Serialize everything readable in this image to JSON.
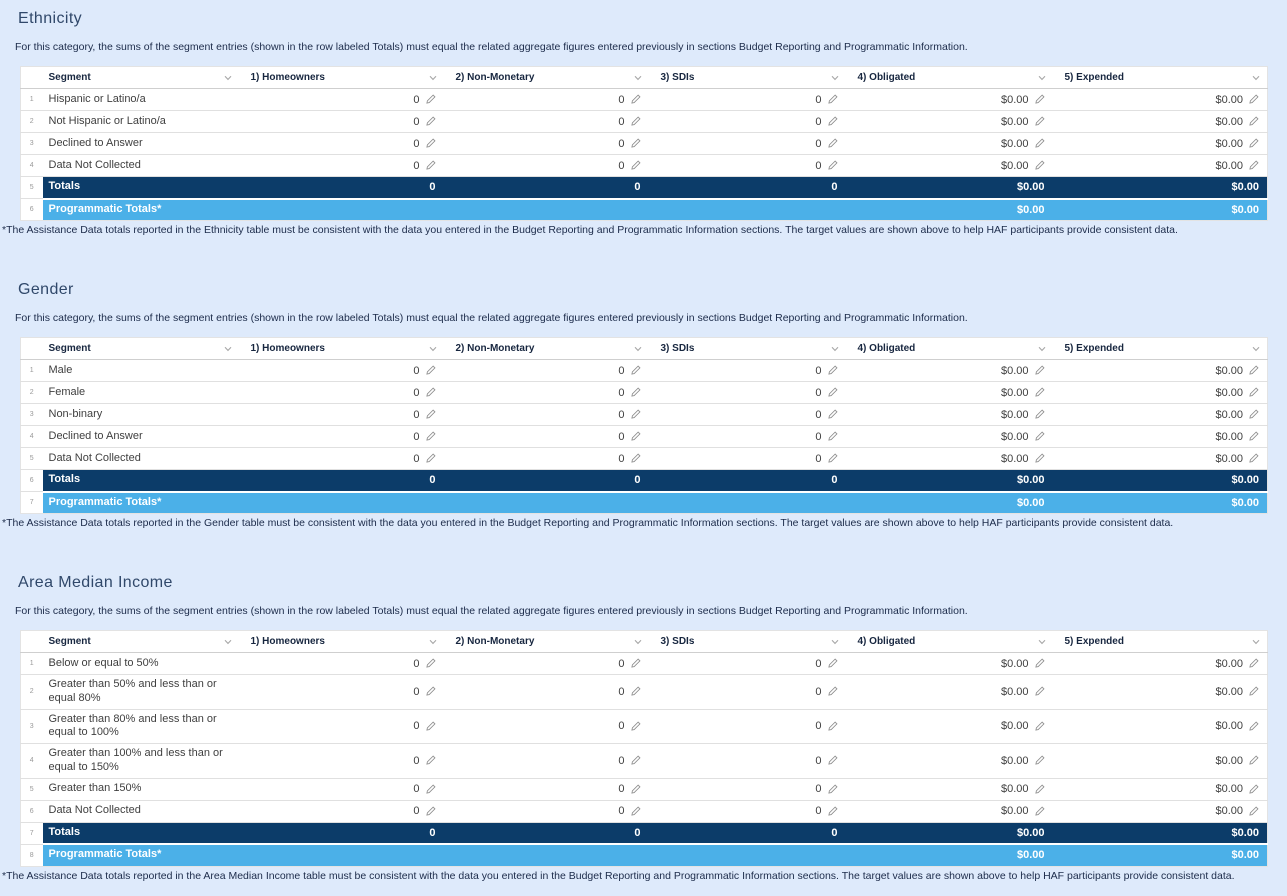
{
  "colors": {
    "page-bg": "#deeafb",
    "navy": "#0c3c69",
    "light-blue": "#4bb0e8",
    "heading": "#30486a"
  },
  "columns": [
    {
      "key": "segment",
      "label": "Segment"
    },
    {
      "key": "homeowners",
      "label": "1) Homeowners"
    },
    {
      "key": "nonmonetary",
      "label": "2) Non-Monetary"
    },
    {
      "key": "sdis",
      "label": "3) SDIs"
    },
    {
      "key": "obligated",
      "label": "4) Obligated"
    },
    {
      "key": "expended",
      "label": "5) Expended"
    }
  ],
  "sections": [
    {
      "id": "ethnicity",
      "title": "Ethnicity",
      "description": "For this category, the sums of the segment entries (shown in the row labeled Totals) must equal the related aggregate figures entered previously in sections Budget Reporting and Programmatic Information.",
      "rows": [
        {
          "index": "1",
          "segment": "Hispanic or Latino/a",
          "values": [
            "0",
            "0",
            "0",
            "$0.00",
            "$0.00"
          ]
        },
        {
          "index": "2",
          "segment": "Not Hispanic or Latino/a",
          "values": [
            "0",
            "0",
            "0",
            "$0.00",
            "$0.00"
          ]
        },
        {
          "index": "3",
          "segment": "Declined to Answer",
          "values": [
            "0",
            "0",
            "0",
            "$0.00",
            "$0.00"
          ]
        },
        {
          "index": "4",
          "segment": "Data Not Collected",
          "values": [
            "0",
            "0",
            "0",
            "$0.00",
            "$0.00"
          ]
        }
      ],
      "totals_row": {
        "index": "5",
        "segment": "Totals",
        "values": [
          "0",
          "0",
          "0",
          "$0.00",
          "$0.00"
        ]
      },
      "programmatic_row": {
        "index": "6",
        "segment": "Programmatic Totals*",
        "values": [
          "",
          "",
          "",
          "$0.00",
          "$0.00"
        ]
      },
      "footnote": "*The Assistance Data totals reported in the Ethnicity table must be consistent with the data you entered in the Budget Reporting and Programmatic Information sections. The target values are shown above to help HAF participants provide consistent data."
    },
    {
      "id": "gender",
      "title": "Gender",
      "description": "For this category, the sums of the segment entries (shown in the row labeled Totals) must equal the related aggregate figures entered previously in sections Budget Reporting and Programmatic Information.",
      "rows": [
        {
          "index": "1",
          "segment": "Male",
          "values": [
            "0",
            "0",
            "0",
            "$0.00",
            "$0.00"
          ]
        },
        {
          "index": "2",
          "segment": "Female",
          "values": [
            "0",
            "0",
            "0",
            "$0.00",
            "$0.00"
          ]
        },
        {
          "index": "3",
          "segment": "Non-binary",
          "values": [
            "0",
            "0",
            "0",
            "$0.00",
            "$0.00"
          ]
        },
        {
          "index": "4",
          "segment": "Declined to Answer",
          "values": [
            "0",
            "0",
            "0",
            "$0.00",
            "$0.00"
          ]
        },
        {
          "index": "5",
          "segment": "Data Not Collected",
          "values": [
            "0",
            "0",
            "0",
            "$0.00",
            "$0.00"
          ]
        }
      ],
      "totals_row": {
        "index": "6",
        "segment": "Totals",
        "values": [
          "0",
          "0",
          "0",
          "$0.00",
          "$0.00"
        ]
      },
      "programmatic_row": {
        "index": "7",
        "segment": "Programmatic Totals*",
        "values": [
          "",
          "",
          "",
          "$0.00",
          "$0.00"
        ]
      },
      "footnote": "*The Assistance Data totals reported in the Gender table must be consistent with the data you entered in the Budget Reporting and Programmatic Information sections. The target values are shown above to help HAF participants provide consistent data."
    },
    {
      "id": "area-median-income",
      "title": "Area Median Income",
      "description": "For this category, the sums of the segment entries (shown in the row labeled Totals) must equal the related aggregate figures entered previously in sections Budget Reporting and Programmatic Information.",
      "rows": [
        {
          "index": "1",
          "segment": "Below or equal to 50%",
          "values": [
            "0",
            "0",
            "0",
            "$0.00",
            "$0.00"
          ]
        },
        {
          "index": "2",
          "segment": "Greater than 50% and less than or equal 80%",
          "values": [
            "0",
            "0",
            "0",
            "$0.00",
            "$0.00"
          ]
        },
        {
          "index": "3",
          "segment": "Greater than 80% and less than or equal to 100%",
          "values": [
            "0",
            "0",
            "0",
            "$0.00",
            "$0.00"
          ]
        },
        {
          "index": "4",
          "segment": "Greater than 100% and less than or equal to 150%",
          "values": [
            "0",
            "0",
            "0",
            "$0.00",
            "$0.00"
          ]
        },
        {
          "index": "5",
          "segment": "Greater than 150%",
          "values": [
            "0",
            "0",
            "0",
            "$0.00",
            "$0.00"
          ]
        },
        {
          "index": "6",
          "segment": "Data Not Collected",
          "values": [
            "0",
            "0",
            "0",
            "$0.00",
            "$0.00"
          ]
        }
      ],
      "totals_row": {
        "index": "7",
        "segment": "Totals",
        "values": [
          "0",
          "0",
          "0",
          "$0.00",
          "$0.00"
        ]
      },
      "programmatic_row": {
        "index": "8",
        "segment": "Programmatic Totals*",
        "values": [
          "",
          "",
          "",
          "$0.00",
          "$0.00"
        ]
      },
      "footnote": "*The Assistance Data totals reported in the Area Median Income table must be consistent with the data you entered in the Budget Reporting and Programmatic Information sections. The target values are shown above to help HAF participants provide consistent data."
    }
  ],
  "icons": {
    "chevron": "chevron-down-icon",
    "pencil": "edit-pencil-icon"
  }
}
